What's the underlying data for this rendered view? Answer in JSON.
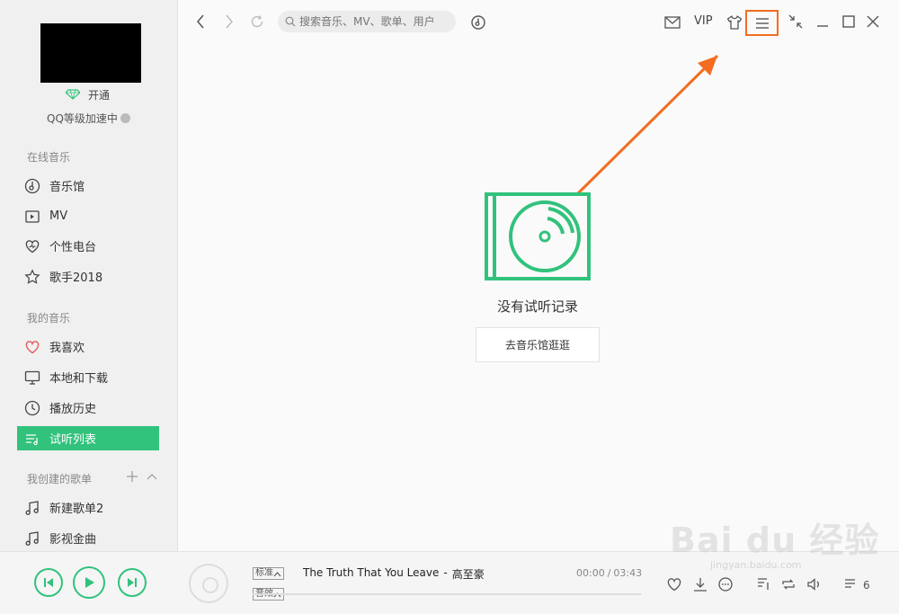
{
  "sidebar": {
    "vip_open": "开通",
    "qq_level": "QQ等级加速中",
    "online_music_title": "在线音乐",
    "online_music": [
      {
        "label": "音乐馆",
        "icon": "music-hall-icon"
      },
      {
        "label": "MV",
        "icon": "mv-icon"
      },
      {
        "label": "个性电台",
        "icon": "radio-icon"
      },
      {
        "label": "歌手2018",
        "icon": "star-icon"
      }
    ],
    "my_music_title": "我的音乐",
    "my_music": [
      {
        "label": "我喜欢",
        "icon": "heart-icon"
      },
      {
        "label": "本地和下载",
        "icon": "monitor-icon"
      },
      {
        "label": "播放历史",
        "icon": "clock-icon"
      },
      {
        "label": "试听列表",
        "icon": "playlist-icon",
        "active": true
      }
    ],
    "created_title": "我创建的歌单",
    "created": [
      {
        "label": "新建歌单2",
        "icon": "music-note-icon"
      },
      {
        "label": "影视金曲",
        "icon": "music-note-icon"
      }
    ]
  },
  "topbar": {
    "search_placeholder": "搜索音乐、MV、歌单、用户",
    "vip_label": "VIP"
  },
  "main": {
    "empty_text": "没有试听记录",
    "goto_button": "去音乐馆逛逛"
  },
  "player": {
    "quality_tag": "标准",
    "effect_tag": "音效",
    "song_title": "The Truth That You Leave",
    "separator": "-",
    "artist": "高至豪",
    "current_time": "00:00",
    "time_separator": "/",
    "total_time": "03:43",
    "progress": 0,
    "queue_count": "6"
  },
  "watermark": {
    "brand": "Bai du 经验",
    "sub": "jingyan.baidu.com"
  },
  "colors": {
    "accent": "#31c27c",
    "annotation": "#f26d21"
  }
}
